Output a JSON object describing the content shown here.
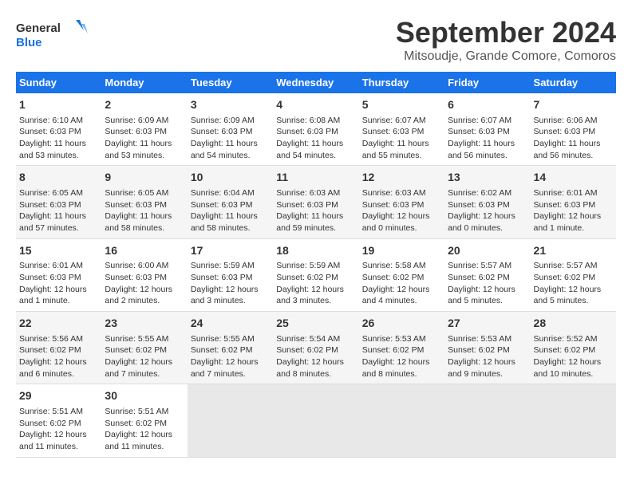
{
  "header": {
    "logo_line1": "General",
    "logo_line2": "Blue",
    "title": "September 2024",
    "subtitle": "Mitsoudje, Grande Comore, Comoros"
  },
  "calendar": {
    "days_of_week": [
      "Sunday",
      "Monday",
      "Tuesday",
      "Wednesday",
      "Thursday",
      "Friday",
      "Saturday"
    ],
    "weeks": [
      [
        {
          "day": "1",
          "data": "Sunrise: 6:10 AM\nSunset: 6:03 PM\nDaylight: 11 hours\nand 53 minutes."
        },
        {
          "day": "2",
          "data": "Sunrise: 6:09 AM\nSunset: 6:03 PM\nDaylight: 11 hours\nand 53 minutes."
        },
        {
          "day": "3",
          "data": "Sunrise: 6:09 AM\nSunset: 6:03 PM\nDaylight: 11 hours\nand 54 minutes."
        },
        {
          "day": "4",
          "data": "Sunrise: 6:08 AM\nSunset: 6:03 PM\nDaylight: 11 hours\nand 54 minutes."
        },
        {
          "day": "5",
          "data": "Sunrise: 6:07 AM\nSunset: 6:03 PM\nDaylight: 11 hours\nand 55 minutes."
        },
        {
          "day": "6",
          "data": "Sunrise: 6:07 AM\nSunset: 6:03 PM\nDaylight: 11 hours\nand 56 minutes."
        },
        {
          "day": "7",
          "data": "Sunrise: 6:06 AM\nSunset: 6:03 PM\nDaylight: 11 hours\nand 56 minutes."
        }
      ],
      [
        {
          "day": "8",
          "data": "Sunrise: 6:05 AM\nSunset: 6:03 PM\nDaylight: 11 hours\nand 57 minutes."
        },
        {
          "day": "9",
          "data": "Sunrise: 6:05 AM\nSunset: 6:03 PM\nDaylight: 11 hours\nand 58 minutes."
        },
        {
          "day": "10",
          "data": "Sunrise: 6:04 AM\nSunset: 6:03 PM\nDaylight: 11 hours\nand 58 minutes."
        },
        {
          "day": "11",
          "data": "Sunrise: 6:03 AM\nSunset: 6:03 PM\nDaylight: 11 hours\nand 59 minutes."
        },
        {
          "day": "12",
          "data": "Sunrise: 6:03 AM\nSunset: 6:03 PM\nDaylight: 12 hours\nand 0 minutes."
        },
        {
          "day": "13",
          "data": "Sunrise: 6:02 AM\nSunset: 6:03 PM\nDaylight: 12 hours\nand 0 minutes."
        },
        {
          "day": "14",
          "data": "Sunrise: 6:01 AM\nSunset: 6:03 PM\nDaylight: 12 hours\nand 1 minute."
        }
      ],
      [
        {
          "day": "15",
          "data": "Sunrise: 6:01 AM\nSunset: 6:03 PM\nDaylight: 12 hours\nand 1 minute."
        },
        {
          "day": "16",
          "data": "Sunrise: 6:00 AM\nSunset: 6:03 PM\nDaylight: 12 hours\nand 2 minutes."
        },
        {
          "day": "17",
          "data": "Sunrise: 5:59 AM\nSunset: 6:03 PM\nDaylight: 12 hours\nand 3 minutes."
        },
        {
          "day": "18",
          "data": "Sunrise: 5:59 AM\nSunset: 6:02 PM\nDaylight: 12 hours\nand 3 minutes."
        },
        {
          "day": "19",
          "data": "Sunrise: 5:58 AM\nSunset: 6:02 PM\nDaylight: 12 hours\nand 4 minutes."
        },
        {
          "day": "20",
          "data": "Sunrise: 5:57 AM\nSunset: 6:02 PM\nDaylight: 12 hours\nand 5 minutes."
        },
        {
          "day": "21",
          "data": "Sunrise: 5:57 AM\nSunset: 6:02 PM\nDaylight: 12 hours\nand 5 minutes."
        }
      ],
      [
        {
          "day": "22",
          "data": "Sunrise: 5:56 AM\nSunset: 6:02 PM\nDaylight: 12 hours\nand 6 minutes."
        },
        {
          "day": "23",
          "data": "Sunrise: 5:55 AM\nSunset: 6:02 PM\nDaylight: 12 hours\nand 7 minutes."
        },
        {
          "day": "24",
          "data": "Sunrise: 5:55 AM\nSunset: 6:02 PM\nDaylight: 12 hours\nand 7 minutes."
        },
        {
          "day": "25",
          "data": "Sunrise: 5:54 AM\nSunset: 6:02 PM\nDaylight: 12 hours\nand 8 minutes."
        },
        {
          "day": "26",
          "data": "Sunrise: 5:53 AM\nSunset: 6:02 PM\nDaylight: 12 hours\nand 8 minutes."
        },
        {
          "day": "27",
          "data": "Sunrise: 5:53 AM\nSunset: 6:02 PM\nDaylight: 12 hours\nand 9 minutes."
        },
        {
          "day": "28",
          "data": "Sunrise: 5:52 AM\nSunset: 6:02 PM\nDaylight: 12 hours\nand 10 minutes."
        }
      ],
      [
        {
          "day": "29",
          "data": "Sunrise: 5:51 AM\nSunset: 6:02 PM\nDaylight: 12 hours\nand 11 minutes."
        },
        {
          "day": "30",
          "data": "Sunrise: 5:51 AM\nSunset: 6:02 PM\nDaylight: 12 hours\nand 11 minutes."
        },
        {
          "day": "",
          "data": ""
        },
        {
          "day": "",
          "data": ""
        },
        {
          "day": "",
          "data": ""
        },
        {
          "day": "",
          "data": ""
        },
        {
          "day": "",
          "data": ""
        }
      ]
    ]
  }
}
